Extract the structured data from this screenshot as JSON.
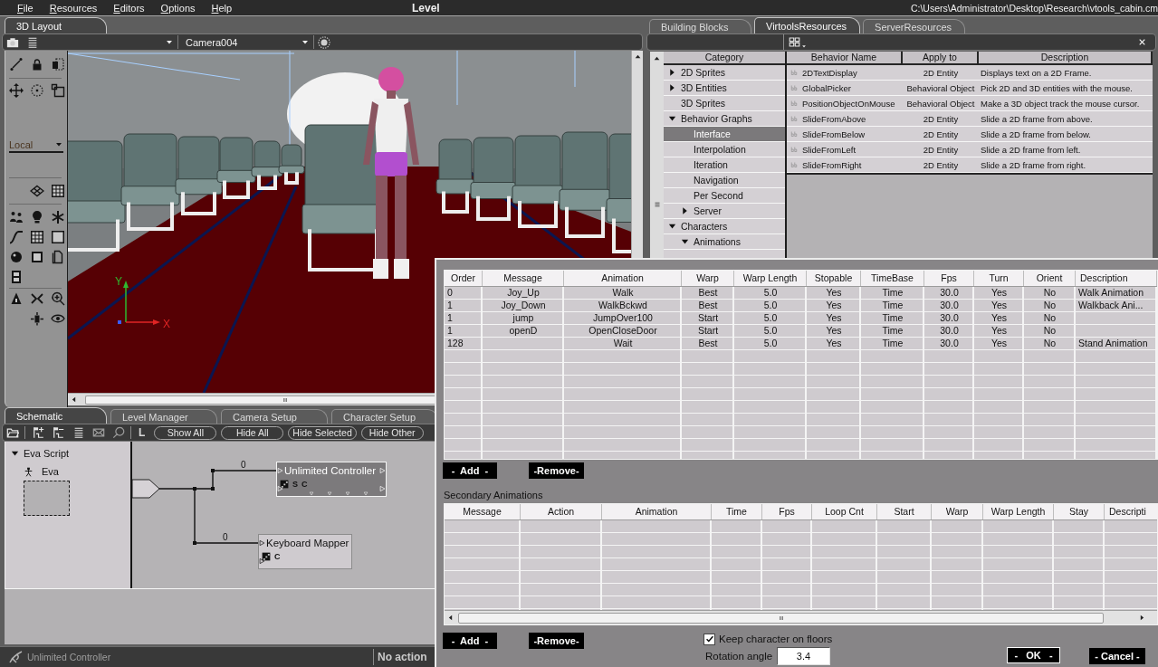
{
  "menu_bar": {
    "items": [
      "File",
      "Resources",
      "Editors",
      "Options",
      "Help"
    ],
    "title": "Level",
    "file_path": "C:\\Users\\Administrator\\Desktop\\Research\\vtools_cabin.cm"
  },
  "layout_panel": {
    "tabs": [
      {
        "label": "3D Layout",
        "selected": true
      }
    ],
    "camera_dropdown": {
      "value": "Camera004"
    },
    "coordinate_dropdown": {
      "value": "Local"
    },
    "viewport": {
      "axis_labels": [
        "Y",
        "X"
      ]
    }
  },
  "resources_panel": {
    "tabs": [
      {
        "label": "Building Blocks",
        "selected": false
      },
      {
        "label": "VirtoolsResources",
        "selected": true
      },
      {
        "label": "ServerResources",
        "selected": false
      }
    ],
    "category_header": "Category",
    "categories": [
      {
        "label": "2D Sprites",
        "kind": "group",
        "expanded": false,
        "selected": false
      },
      {
        "label": "3D Entities",
        "kind": "group",
        "expanded": false,
        "selected": false
      },
      {
        "label": "3D Sprites",
        "kind": "leaf",
        "selected": false
      },
      {
        "label": "Behavior Graphs",
        "kind": "group",
        "expanded": true,
        "selected": false,
        "children": [
          {
            "label": "Interface",
            "kind": "leaf",
            "selected": true
          },
          {
            "label": "Interpolation",
            "kind": "leaf",
            "selected": false
          },
          {
            "label": "Iteration",
            "kind": "leaf",
            "selected": false
          },
          {
            "label": "Navigation",
            "kind": "leaf",
            "selected": false
          },
          {
            "label": "Per Second",
            "kind": "leaf",
            "selected": false
          },
          {
            "label": "Server",
            "kind": "group",
            "expanded": false,
            "selected": false
          }
        ]
      },
      {
        "label": "Characters",
        "kind": "group",
        "expanded": true,
        "selected": false,
        "children": [
          {
            "label": "Animations",
            "kind": "group",
            "expanded": true,
            "selected": false
          }
        ]
      }
    ],
    "behavior_columns": [
      "Behavior Name",
      "Apply to",
      "Description"
    ],
    "behaviors": [
      {
        "name": "2DTextDisplay",
        "apply_to": "2D Entity",
        "description": "Displays text on a 2D Frame."
      },
      {
        "name": "GlobalPicker",
        "apply_to": "Behavioral Object",
        "description": "Pick 2D and 3D entities with the mouse."
      },
      {
        "name": "PositionObjectOnMouse",
        "apply_to": "Behavioral Object",
        "description": "Make a 3D object track the mouse cursor."
      },
      {
        "name": "SlideFromAbove",
        "apply_to": "2D Entity",
        "description": "Slide a 2D frame from above."
      },
      {
        "name": "SlideFromBelow",
        "apply_to": "2D Entity",
        "description": "Slide a 2D frame from below."
      },
      {
        "name": "SlideFromLeft",
        "apply_to": "2D Entity",
        "description": "Slide a 2D frame from left."
      },
      {
        "name": "SlideFromRight",
        "apply_to": "2D Entity",
        "description": "Slide a 2D frame from right."
      }
    ]
  },
  "schematic_panel": {
    "tabs": [
      {
        "label": "Schematic",
        "selected": true
      },
      {
        "label": "Level Manager",
        "selected": false
      },
      {
        "label": "Camera Setup",
        "selected": false
      },
      {
        "label": "Character Setup",
        "selected": false
      }
    ],
    "toolbar_letter": "L",
    "toolbar_buttons": [
      "Show All",
      "Hide All",
      "Hide Selected",
      "Hide Other"
    ],
    "scripts": [
      {
        "label": "Eva Script",
        "expanded": true,
        "children": [
          {
            "label": "Eva"
          }
        ]
      }
    ],
    "nodes": [
      {
        "label": "Unlimited Controller",
        "selected": true,
        "flags": [
          "S",
          "C"
        ]
      },
      {
        "label": "Keyboard Mapper",
        "selected": false,
        "flags": [
          "C"
        ]
      }
    ],
    "links": [
      {
        "label": "0"
      },
      {
        "label": "0"
      }
    ]
  },
  "status_bar": {
    "selection": "Unlimited Controller",
    "action": "No action"
  },
  "dialog": {
    "primary_table": {
      "columns": [
        "Order",
        "Message",
        "Animation",
        "Warp",
        "Warp Length",
        "Stopable",
        "TimeBase",
        "Fps",
        "Turn",
        "Orient",
        "Description"
      ],
      "rows": [
        {
          "order": "0",
          "message": "Joy_Up",
          "animation": "Walk",
          "warp": "Best",
          "warp_length": "5.0",
          "stopable": "Yes",
          "timebase": "Time",
          "fps": "30.0",
          "turn": "Yes",
          "orient": "No",
          "description": "Walk Animation"
        },
        {
          "order": "1",
          "message": "Joy_Down",
          "animation": "WalkBckwd",
          "warp": "Best",
          "warp_length": "5.0",
          "stopable": "Yes",
          "timebase": "Time",
          "fps": "30.0",
          "turn": "Yes",
          "orient": "No",
          "description": "Walkback Ani..."
        },
        {
          "order": "1",
          "message": "jump",
          "animation": "JumpOver100",
          "warp": "Start",
          "warp_length": "5.0",
          "stopable": "Yes",
          "timebase": "Time",
          "fps": "30.0",
          "turn": "Yes",
          "orient": "No"
        },
        {
          "order": "1",
          "message": "openD",
          "animation": "OpenCloseDoor",
          "warp": "Start",
          "warp_length": "5.0",
          "stopable": "Yes",
          "timebase": "Time",
          "fps": "30.0",
          "turn": "Yes",
          "orient": "No"
        },
        {
          "order": "128",
          "animation": "Wait",
          "warp": "Best",
          "warp_length": "5.0",
          "stopable": "Yes",
          "timebase": "Time",
          "fps": "30.0",
          "turn": "Yes",
          "orient": "No",
          "description": "Stand Animation"
        }
      ]
    },
    "primary_buttons": [
      "-  Add  -",
      "-Remove-"
    ],
    "secondary_title": "Secondary Animations",
    "secondary_table": {
      "columns": [
        "Message",
        "Action",
        "Animation",
        "Time",
        "Fps",
        "Loop Cnt",
        "Start",
        "Warp",
        "Warp Length",
        "Stay",
        "Descripti"
      ]
    },
    "secondary_buttons": [
      "-  Add  -",
      "-Remove-"
    ],
    "keep_on_floors": {
      "label": "Keep character on floors",
      "checked": true
    },
    "rotation_angle": {
      "label": "Rotation angle",
      "value": "3.4"
    },
    "confirm_buttons": [
      {
        "label": "-   OK   -",
        "kind": "default"
      },
      {
        "label": "- Cancel -",
        "kind": "normal"
      }
    ]
  }
}
